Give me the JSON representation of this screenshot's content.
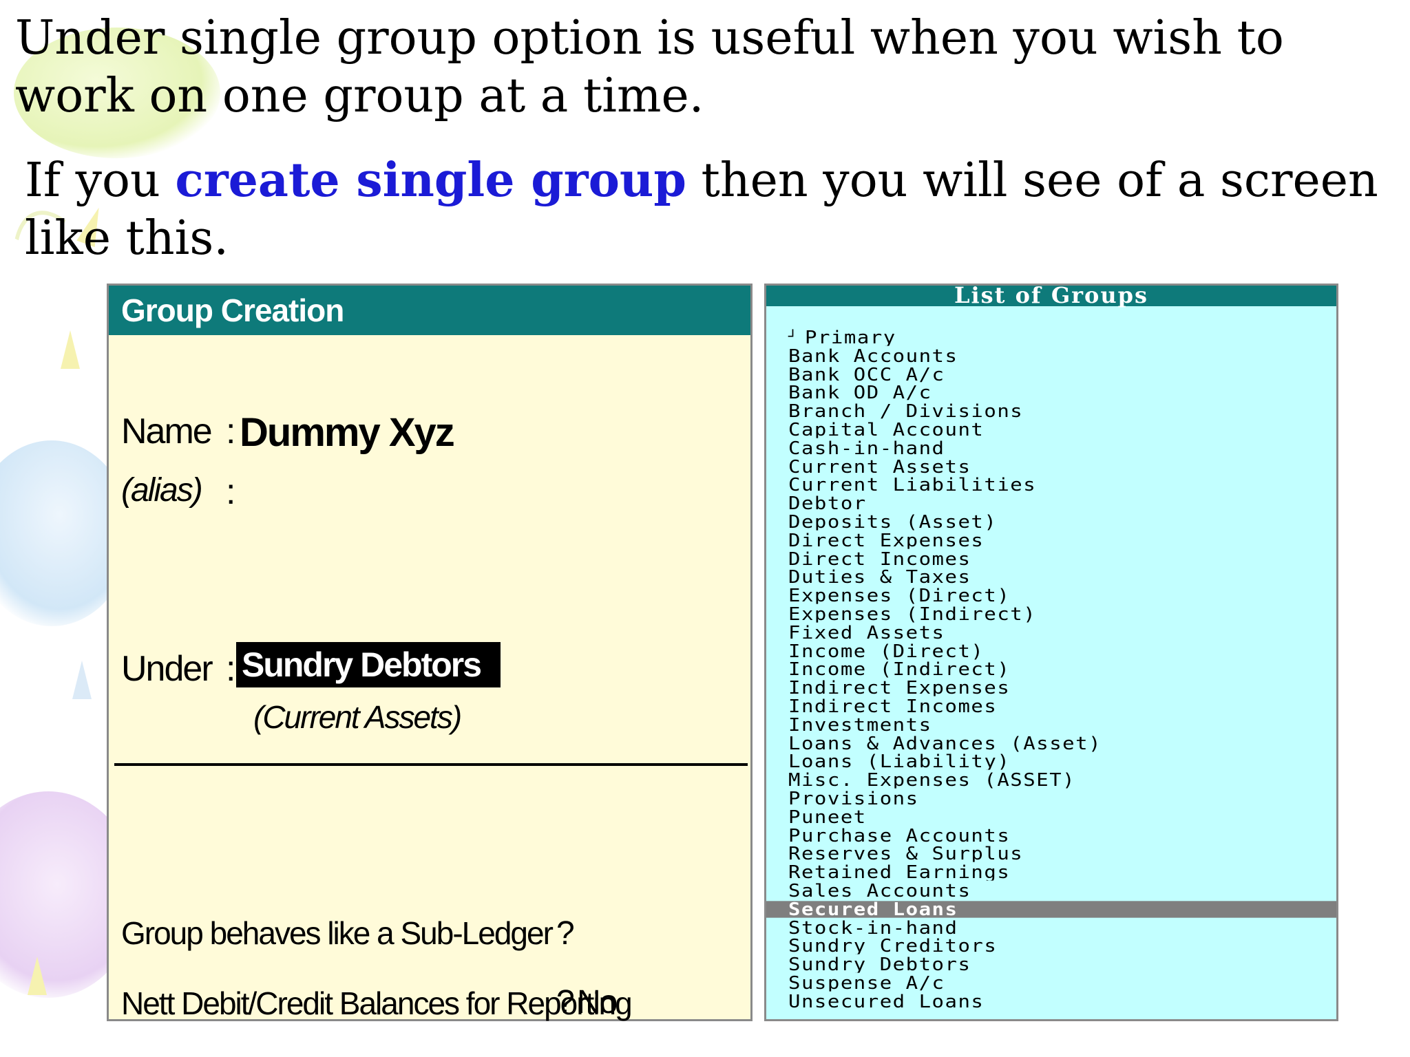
{
  "intro": {
    "line1": "Under single group option is useful when you wish to work on one group at a time.",
    "line2_pre": "If you ",
    "line2_highlight": "create single group",
    "line2_post": " then you will see of a screen like this."
  },
  "group_creation": {
    "title": "Group Creation",
    "name_label": "Name",
    "name_value": "Dummy Xyz",
    "alias_label": "(alias)",
    "colon": ":",
    "under_label": "Under",
    "under_value": "Sundry Debtors",
    "parent_value": "(Current Assets)",
    "sub_ledger_label": "Group behaves like a Sub-Ledger",
    "sub_ledger_mark": "?",
    "nett_label": "Nett Debit/Credit Balances for Reporting",
    "nett_mark": "?",
    "nett_value": "No"
  },
  "list_of_groups": {
    "title": "List of Groups",
    "primary_mark": "┘",
    "items": [
      "Primary",
      "Bank Accounts",
      "Bank OCC A/c",
      "Bank OD A/c",
      "Branch / Divisions",
      "Capital Account",
      "Cash-in-hand",
      "Current Assets",
      "Current Liabilities",
      "Debtor",
      "Deposits (Asset)",
      "Direct Expenses",
      "Direct Incomes",
      "Duties & Taxes",
      "Expenses (Direct)",
      "Expenses (Indirect)",
      "Fixed Assets",
      "Income (Direct)",
      "Income (Indirect)",
      "Indirect Expenses",
      "Indirect Incomes",
      "Investments",
      "Loans & Advances (Asset)",
      "Loans (Liability)",
      "Misc. Expenses (ASSET)",
      "Provisions",
      "Puneet",
      "Purchase Accounts",
      "Reserves & Surplus",
      "Retained Earnings",
      "Sales Accounts",
      "Secured Loans",
      "Stock-in-hand",
      "Sundry Creditors",
      "Sundry Debtors",
      "Suspense A/c",
      "Unsecured Loans"
    ],
    "selected_index": 31
  }
}
